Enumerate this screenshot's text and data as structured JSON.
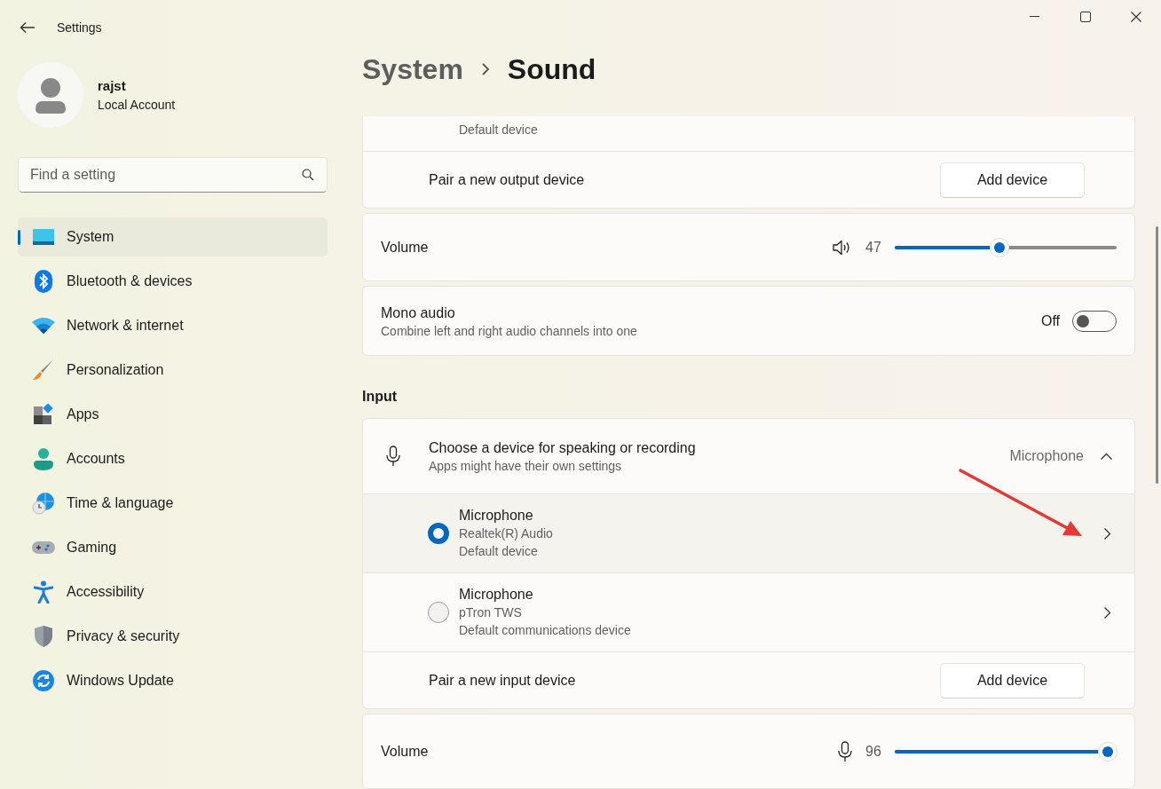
{
  "window": {
    "title": "Settings"
  },
  "account": {
    "name": "rajst",
    "type": "Local Account"
  },
  "search": {
    "placeholder": "Find a setting"
  },
  "sidebar": {
    "items": [
      {
        "label": "System",
        "selected": true
      },
      {
        "label": "Bluetooth & devices",
        "selected": false
      },
      {
        "label": "Network & internet",
        "selected": false
      },
      {
        "label": "Personalization",
        "selected": false
      },
      {
        "label": "Apps",
        "selected": false
      },
      {
        "label": "Accounts",
        "selected": false
      },
      {
        "label": "Time & language",
        "selected": false
      },
      {
        "label": "Gaming",
        "selected": false
      },
      {
        "label": "Accessibility",
        "selected": false
      },
      {
        "label": "Privacy & security",
        "selected": false
      },
      {
        "label": "Windows Update",
        "selected": false
      }
    ]
  },
  "breadcrumb": [
    "System",
    "Sound"
  ],
  "output": {
    "partial_device": {
      "status": "Default device"
    },
    "pair": {
      "label": "Pair a new output device",
      "button": "Add device"
    },
    "volume": {
      "label": "Volume",
      "reading": "47",
      "level": 0.47
    },
    "mono_audio": {
      "title": "Mono audio",
      "description": "Combine left and right audio channels into one",
      "state_label": "Off",
      "on": false
    }
  },
  "input": {
    "heading": "Input",
    "chooser": {
      "title": "Choose a device for speaking or recording",
      "subtitle": "Apps might have their own settings",
      "value": "Microphone",
      "expanded": true
    },
    "devices": [
      {
        "name": "Microphone",
        "detail": "Realtek(R) Audio",
        "status": "Default device",
        "selected": true
      },
      {
        "name": "Microphone",
        "detail": "pTron TWS",
        "status": "Default communications device",
        "selected": false
      }
    ],
    "pair": {
      "label": "Pair a new input device",
      "button": "Add device"
    },
    "volume": {
      "label": "Volume",
      "reading": "96",
      "level": 0.96
    }
  }
}
